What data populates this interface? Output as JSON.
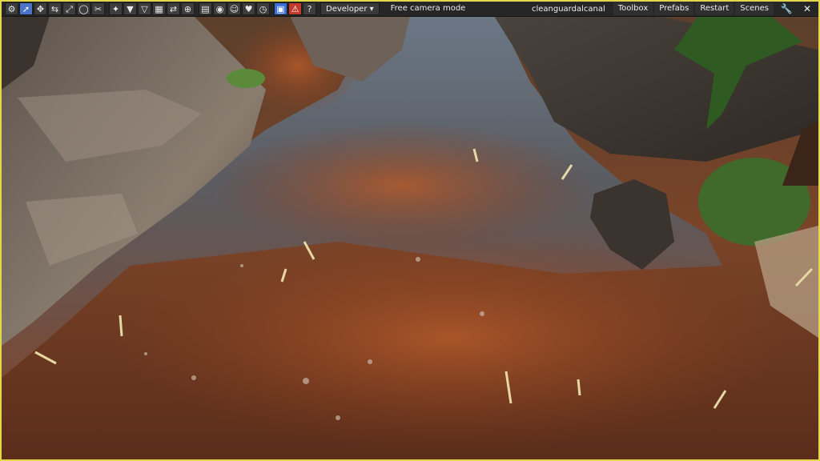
{
  "toolbar": {
    "tools": [
      {
        "name": "settings-icon",
        "glyph": "⚙"
      },
      {
        "name": "select-cursor-icon",
        "glyph": "➚",
        "active": true
      },
      {
        "name": "move-icon",
        "glyph": "✥"
      },
      {
        "name": "rotate-icon",
        "glyph": "⇆"
      },
      {
        "name": "scale-icon",
        "glyph": "⤢"
      },
      {
        "name": "orbit-icon",
        "glyph": "◯"
      },
      {
        "name": "snap-icon",
        "glyph": "✂"
      },
      {
        "name": "transform-icon",
        "glyph": "✦"
      },
      {
        "name": "filter-icon",
        "glyph": "▼"
      },
      {
        "name": "filter-outline-icon",
        "glyph": "▽"
      },
      {
        "name": "grid-icon",
        "glyph": "▦"
      },
      {
        "name": "split-icon",
        "glyph": "⇄"
      },
      {
        "name": "target-icon",
        "glyph": "⊕"
      },
      {
        "name": "document-icon",
        "glyph": "▤"
      },
      {
        "name": "eye-icon",
        "glyph": "◉"
      },
      {
        "name": "mask-icon",
        "glyph": "☺"
      },
      {
        "name": "heart-icon",
        "glyph": "♥"
      },
      {
        "name": "timer-icon",
        "glyph": "◷"
      },
      {
        "name": "save-icon",
        "glyph": "▣",
        "variant": "blue"
      },
      {
        "name": "warning-icon",
        "glyph": "⚠",
        "variant": "warn"
      },
      {
        "name": "help-icon",
        "glyph": "?"
      }
    ],
    "mode_dropdown": "Developer ▾",
    "camera_mode": "Free camera mode",
    "scene_name": "cleanguardalcanal",
    "menu": [
      "Toolbox",
      "Prefabs",
      "Restart",
      "Scenes"
    ],
    "right_icons": [
      {
        "name": "wrench-icon",
        "glyph": "🔧"
      },
      {
        "name": "close-icon",
        "glyph": "✕"
      }
    ]
  },
  "colors": {
    "viewport_border": "#e3d84a",
    "toolbar_bg": "#262626",
    "water": "#4a5a66",
    "mud": "#8a4a2a",
    "rock": "#6d625a",
    "foliage": "#3f6a2a"
  }
}
